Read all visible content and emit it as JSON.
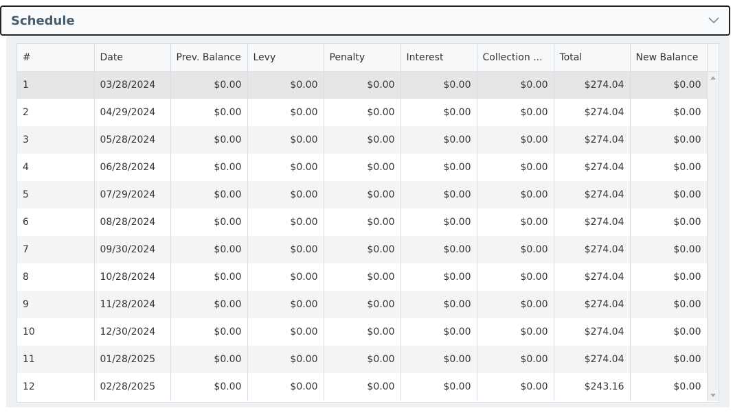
{
  "panel": {
    "title": "Schedule",
    "toggle_icon": "chevron-down-icon"
  },
  "columns": [
    "#",
    "Date",
    "Prev. Balance",
    "Levy",
    "Penalty",
    "Interest",
    "Collection ...",
    "Total",
    "New Balance"
  ],
  "rows": [
    [
      "1",
      "03/28/2024",
      "$0.00",
      "$0.00",
      "$0.00",
      "$0.00",
      "$0.00",
      "$274.04",
      "$0.00"
    ],
    [
      "2",
      "04/29/2024",
      "$0.00",
      "$0.00",
      "$0.00",
      "$0.00",
      "$0.00",
      "$274.04",
      "$0.00"
    ],
    [
      "3",
      "05/28/2024",
      "$0.00",
      "$0.00",
      "$0.00",
      "$0.00",
      "$0.00",
      "$274.04",
      "$0.00"
    ],
    [
      "4",
      "06/28/2024",
      "$0.00",
      "$0.00",
      "$0.00",
      "$0.00",
      "$0.00",
      "$274.04",
      "$0.00"
    ],
    [
      "5",
      "07/29/2024",
      "$0.00",
      "$0.00",
      "$0.00",
      "$0.00",
      "$0.00",
      "$274.04",
      "$0.00"
    ],
    [
      "6",
      "08/28/2024",
      "$0.00",
      "$0.00",
      "$0.00",
      "$0.00",
      "$0.00",
      "$274.04",
      "$0.00"
    ],
    [
      "7",
      "09/30/2024",
      "$0.00",
      "$0.00",
      "$0.00",
      "$0.00",
      "$0.00",
      "$274.04",
      "$0.00"
    ],
    [
      "8",
      "10/28/2024",
      "$0.00",
      "$0.00",
      "$0.00",
      "$0.00",
      "$0.00",
      "$274.04",
      "$0.00"
    ],
    [
      "9",
      "11/28/2024",
      "$0.00",
      "$0.00",
      "$0.00",
      "$0.00",
      "$0.00",
      "$274.04",
      "$0.00"
    ],
    [
      "10",
      "12/30/2024",
      "$0.00",
      "$0.00",
      "$0.00",
      "$0.00",
      "$0.00",
      "$274.04",
      "$0.00"
    ],
    [
      "11",
      "01/28/2025",
      "$0.00",
      "$0.00",
      "$0.00",
      "$0.00",
      "$0.00",
      "$274.04",
      "$0.00"
    ],
    [
      "12",
      "02/28/2025",
      "$0.00",
      "$0.00",
      "$0.00",
      "$0.00",
      "$0.00",
      "$243.16",
      "$0.00"
    ]
  ],
  "colors": {
    "title": "#4a5d6e",
    "border": "#222222",
    "row_alt": "#f4f4f4"
  }
}
